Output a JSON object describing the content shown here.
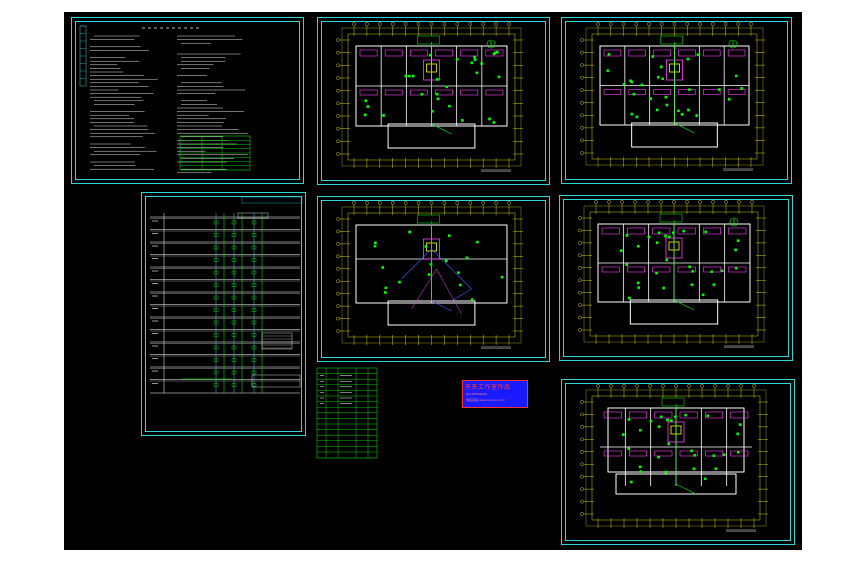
{
  "window": {
    "background": "#000000",
    "frame_color": "#2fd6d6"
  },
  "colors": {
    "wall": "#ffffff",
    "dimension": "#ffff00",
    "room": "#ff40ff",
    "device": "#00ff00",
    "wire": "#4060ff",
    "cyan": "#2fd6d6",
    "stamp_bg": "#1a1aff",
    "stamp_text": "#ff4040"
  },
  "stamp": {
    "title": "天天工作室作品",
    "line1": "QQ:00000000",
    "line2": "淘宝店铺 www.xxxxxx.com"
  },
  "sheets": [
    {
      "id": "notes",
      "kind": "design-notes"
    },
    {
      "id": "system",
      "kind": "riser-diagram"
    },
    {
      "id": "legend",
      "kind": "equipment-table"
    },
    {
      "id": "plan-1",
      "kind": "floor-plan"
    },
    {
      "id": "plan-2",
      "kind": "floor-plan"
    },
    {
      "id": "plan-3",
      "kind": "floor-plan"
    },
    {
      "id": "plan-4",
      "kind": "floor-plan"
    },
    {
      "id": "plan-5",
      "kind": "floor-plan"
    }
  ]
}
